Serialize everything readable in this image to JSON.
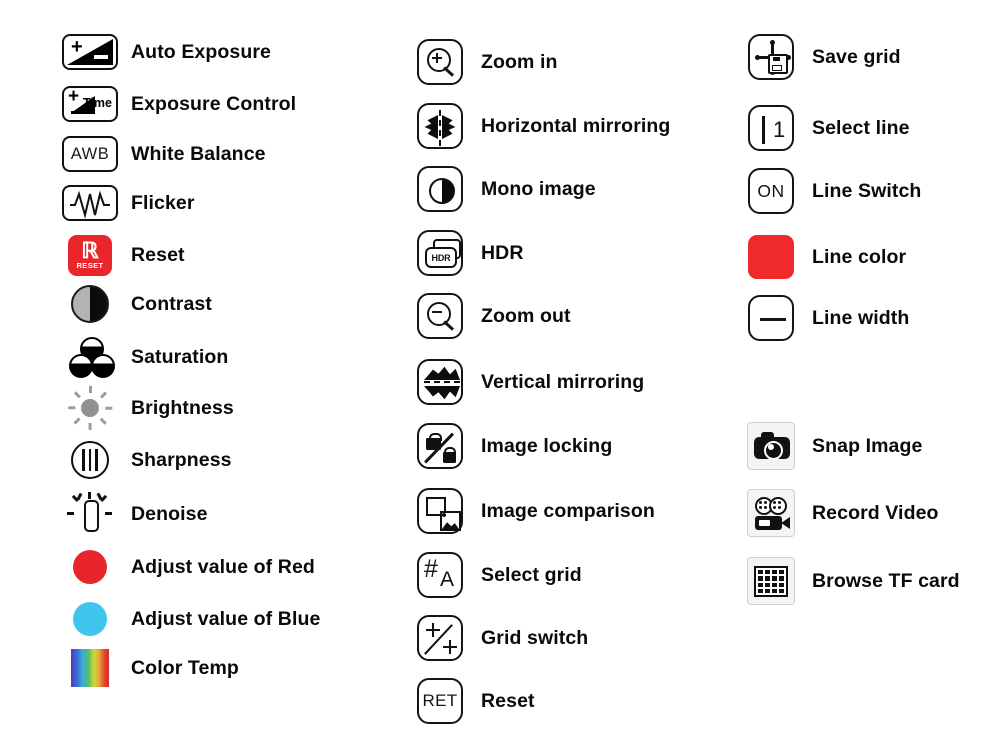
{
  "page": {
    "kind": "icon-legend-sheet",
    "background": "#ffffff",
    "text_color": "#0a0a0a"
  },
  "colors": {
    "reset_red": "#e8262b",
    "line_color_red": "#ee2a2b",
    "adjust_red": "#e8252b",
    "adjust_blue": "#3fc6ef",
    "icon_black": "#111111",
    "brightness_gray": "#949494",
    "tile_gray": "#f4f4f4"
  },
  "columns": [
    {
      "id": "column-camera-image-settings",
      "items": [
        {
          "icon": "auto-exposure-icon",
          "label": "Auto Exposure"
        },
        {
          "icon": "exposure-control-icon",
          "label": "Exposure Control",
          "glyph_text": "Time"
        },
        {
          "icon": "white-balance-icon",
          "label": "White Balance",
          "glyph_text": "AWB"
        },
        {
          "icon": "flicker-icon",
          "label": "Flicker"
        },
        {
          "icon": "reset-icon",
          "label": "Reset",
          "glyph_text": "RESET"
        },
        {
          "icon": "contrast-icon",
          "label": "Contrast"
        },
        {
          "icon": "saturation-icon",
          "label": "Saturation"
        },
        {
          "icon": "brightness-icon",
          "label": "Brightness"
        },
        {
          "icon": "sharpness-icon",
          "label": "Sharpness"
        },
        {
          "icon": "denoise-icon",
          "label": "Denoise"
        },
        {
          "icon": "adjust-red-icon",
          "label": "Adjust value of Red"
        },
        {
          "icon": "adjust-blue-icon",
          "label": "Adjust value of Blue"
        },
        {
          "icon": "color-temp-icon",
          "label": "Color Temp"
        }
      ]
    },
    {
      "id": "column-view-tools",
      "items": [
        {
          "icon": "zoom-in-icon",
          "label": "Zoom in"
        },
        {
          "icon": "horizontal-mirroring-icon",
          "label": "Horizontal mirroring"
        },
        {
          "icon": "mono-image-icon",
          "label": "Mono image"
        },
        {
          "icon": "hdr-icon",
          "label": "HDR",
          "glyph_text": "HDR"
        },
        {
          "icon": "zoom-out-icon",
          "label": "Zoom out"
        },
        {
          "icon": "vertical-mirroring-icon",
          "label": "Vertical mirroring"
        },
        {
          "icon": "image-locking-icon",
          "label": "Image locking"
        },
        {
          "icon": "image-comparison-icon",
          "label": "Image comparison"
        },
        {
          "icon": "select-grid-icon",
          "label": "Select grid",
          "glyph_text": "#A"
        },
        {
          "icon": "grid-switch-icon",
          "label": "Grid switch"
        },
        {
          "icon": "reset-ret-icon",
          "label": "Reset",
          "glyph_text": "RET"
        }
      ]
    },
    {
      "id": "column-grid-line-capture",
      "items": [
        {
          "icon": "save-grid-icon",
          "label": "Save grid"
        },
        {
          "icon": "select-line-icon",
          "label": "Select line",
          "glyph_text": "1"
        },
        {
          "icon": "line-switch-icon",
          "label": "Line Switch",
          "glyph_text": "ON"
        },
        {
          "icon": "line-color-icon",
          "label": "Line color"
        },
        {
          "icon": "line-width-icon",
          "label": "Line width"
        },
        {
          "icon": "snap-image-icon",
          "label": "Snap Image"
        },
        {
          "icon": "record-video-icon",
          "label": "Record Video"
        },
        {
          "icon": "browse-tf-card-icon",
          "label": "Browse TF card"
        }
      ]
    }
  ]
}
